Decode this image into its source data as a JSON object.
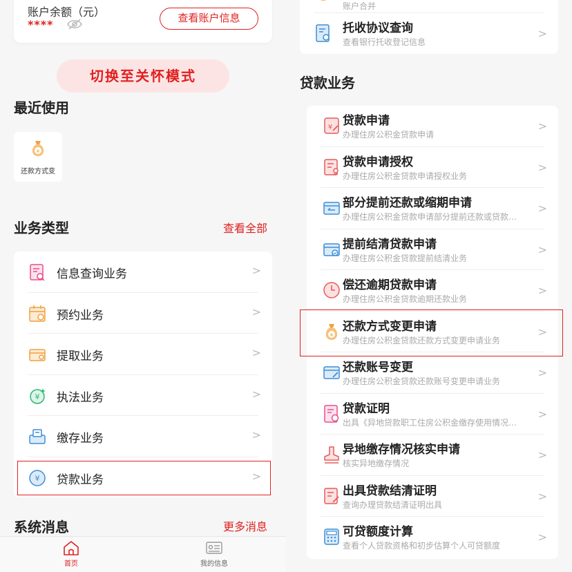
{
  "balance": {
    "label": "账户余额（元）",
    "mask": "****",
    "view_button": "查看账户信息"
  },
  "care_mode": "切换至关怀模式",
  "recent": {
    "title": "最近使用",
    "items": [
      {
        "label": "还款方式变"
      }
    ]
  },
  "business_types": {
    "title": "业务类型",
    "view_all": "查看全部",
    "items": [
      {
        "label": "信息查询业务",
        "icon": "info-query-icon"
      },
      {
        "label": "预约业务",
        "icon": "calendar-icon"
      },
      {
        "label": "提取业务",
        "icon": "wallet-icon"
      },
      {
        "label": "执法业务",
        "icon": "law-icon"
      },
      {
        "label": "缴存业务",
        "icon": "deposit-icon"
      },
      {
        "label": "贷款业务",
        "icon": "yuan-icon"
      }
    ]
  },
  "system_messages": {
    "title": "系统消息",
    "more": "更多消息"
  },
  "tabbar": {
    "home": "首页",
    "my_info": "我的信息"
  },
  "top_list": [
    {
      "title": "",
      "subtitle": "账户合并"
    },
    {
      "title": "托收协议查询",
      "subtitle": "查看银行托收登记信息"
    }
  ],
  "loan_section": {
    "title": "贷款业务",
    "items": [
      {
        "title": "贷款申请",
        "subtitle": "办理住房公积金贷款申请"
      },
      {
        "title": "贷款申请授权",
        "subtitle": "办理住房公积金贷款申请授权业务"
      },
      {
        "title": "部分提前还款或缩期申请",
        "subtitle": "办理住房公积金贷款申请部分提前还款或贷款…"
      },
      {
        "title": "提前结清贷款申请",
        "subtitle": "办理住房公积金贷款提前结清业务"
      },
      {
        "title": "偿还逾期贷款申请",
        "subtitle": "办理住房公积金贷款逾期还款业务"
      },
      {
        "title": "还款方式变更申请",
        "subtitle": "办理住房公积金贷款还款方式变更申请业务"
      },
      {
        "title": "还款账号变更",
        "subtitle": "办理住房公积金贷款还款账号变更申请业务"
      },
      {
        "title": "贷款证明",
        "subtitle": "出具《异地贷款职工住房公积金缴存使用情况…"
      },
      {
        "title": "异地缴存情况核实申请",
        "subtitle": "核实异地缴存情况"
      },
      {
        "title": "出具贷款结清证明",
        "subtitle": "查询办理贷款结清证明出具"
      },
      {
        "title": "可贷额度计算",
        "subtitle": "查看个人贷款资格和初步估算个人可贷额度"
      }
    ]
  },
  "colors": {
    "accent": "#e02020",
    "orange": "#f0a040",
    "blue": "#3a8fd8",
    "green": "#2bb673",
    "pink": "#e94f8a"
  }
}
